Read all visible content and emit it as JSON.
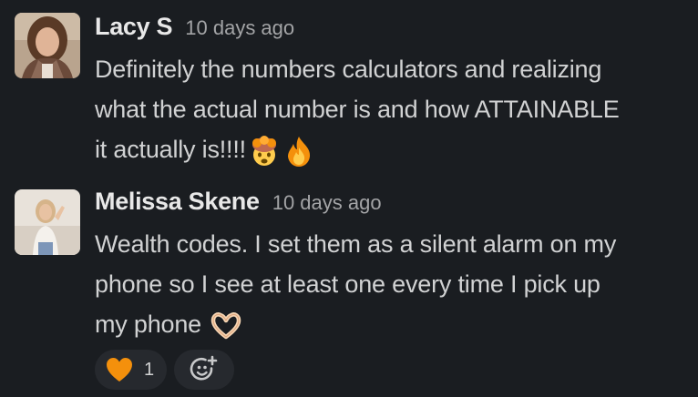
{
  "messages": [
    {
      "author": "Lacy S",
      "timestamp": "10 days ago",
      "text_line_1": "Definitely the numbers calculators and realizing",
      "text_line_2": "what the actual number is and how ATTAINABLE",
      "text_line_3": "it actually is!!!!",
      "emojis": [
        "exploding-head-emoji",
        "fire-emoji"
      ]
    },
    {
      "author": "Melissa Skene",
      "timestamp": "10 days ago",
      "text_line_1": "Wealth codes. I set them as a silent alarm on my",
      "text_line_2": "phone so I see at least one every time I pick up",
      "text_line_3": "my phone",
      "emojis": [
        "heart-hands-emoji"
      ],
      "reactions": [
        {
          "emoji": "orange-heart-emoji",
          "count": "1"
        }
      ]
    }
  ],
  "colors": {
    "background": "#1a1d21",
    "text": "#d1d2d3",
    "author": "#e8e8e8",
    "timestamp": "#a3a4a6",
    "reaction_pill": "#26292e",
    "orange_heart": "#f4900c"
  }
}
